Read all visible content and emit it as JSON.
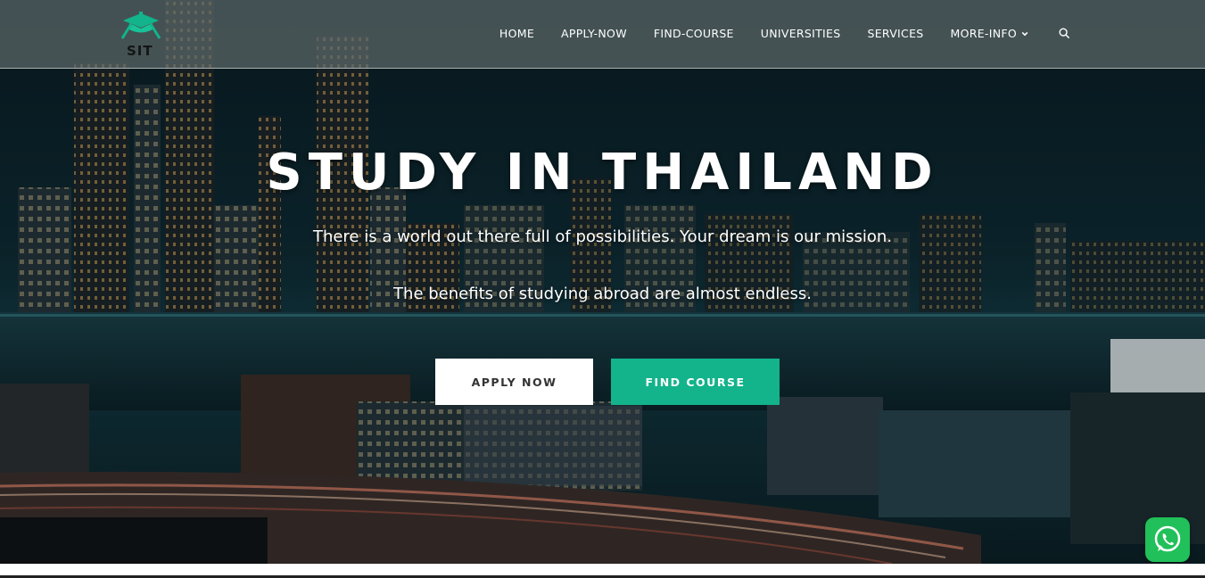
{
  "brand": {
    "logo_text": "SIT"
  },
  "nav": {
    "items": [
      "HOME",
      "APPLY-NOW",
      "FIND-COURSE",
      "UNIVERSITIES",
      "SERVICES",
      "MORE-INFO"
    ],
    "search_icon": "search-icon",
    "dropdown_icon": "chevron-down-icon"
  },
  "hero": {
    "title": "STUDY IN THAILAND",
    "subtitle_1": "There is a world out there full of possibilities. Your dream is our mission.",
    "subtitle_2": "The benefits of studying abroad are almost endless.",
    "apply_button": "APPLY NOW",
    "find_button": "FIND COURSE"
  },
  "colors": {
    "accent": "#13b38b",
    "whatsapp": "#21c05a"
  },
  "whatsapp": {
    "icon": "whatsapp-icon"
  }
}
